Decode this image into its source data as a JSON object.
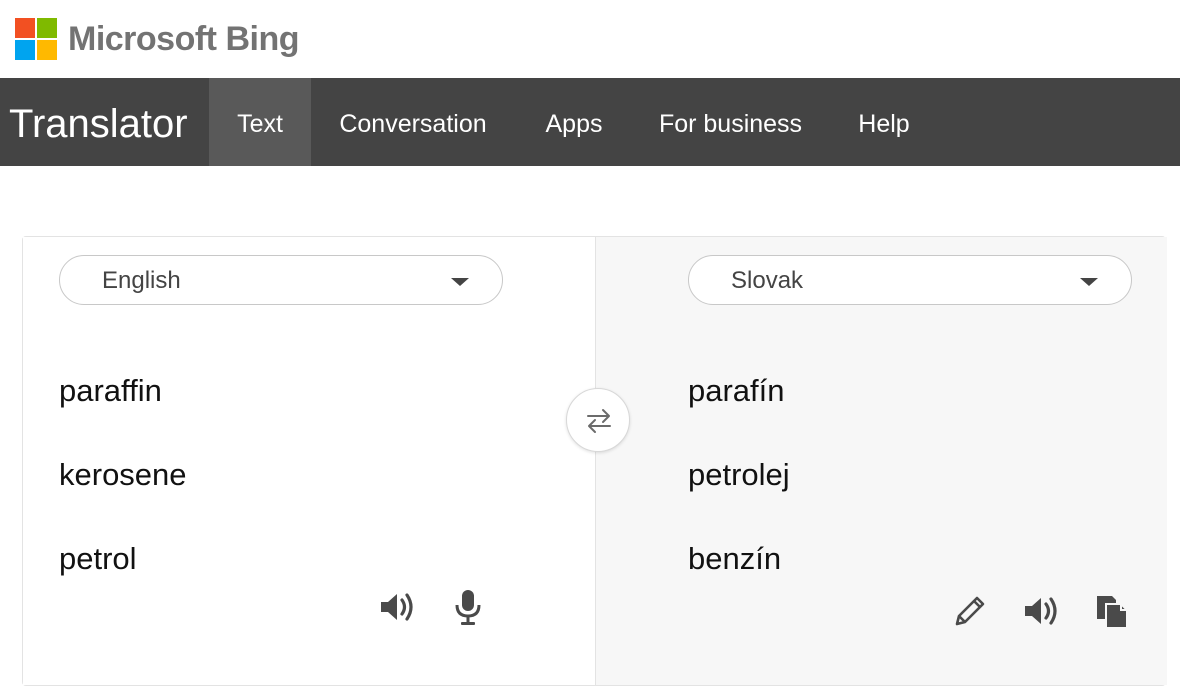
{
  "brand": {
    "name": "Microsoft Bing",
    "logo_colors": [
      "#f25022",
      "#7fba00",
      "#00a4ef",
      "#ffb900"
    ]
  },
  "nav": {
    "title": "Translator",
    "items": [
      {
        "label": "Text",
        "active": true
      },
      {
        "label": "Conversation",
        "active": false
      },
      {
        "label": "Apps",
        "active": false
      },
      {
        "label": "For business",
        "active": false
      },
      {
        "label": "Help",
        "active": false
      }
    ]
  },
  "source": {
    "language": "English",
    "words": [
      "paraffin",
      "kerosene",
      "petrol"
    ],
    "icons": [
      "speaker-icon",
      "microphone-icon"
    ]
  },
  "target": {
    "language": "Slovak",
    "words": [
      "parafín",
      "petrolej",
      "benzín"
    ],
    "icons": [
      "pencil-icon",
      "speaker-icon",
      "copy-icon"
    ]
  },
  "swap": {
    "icon": "swap-arrows-icon"
  },
  "colors": {
    "nav_bg": "#444444",
    "nav_active": "#595959",
    "target_pane_bg": "#f7f7f7"
  }
}
